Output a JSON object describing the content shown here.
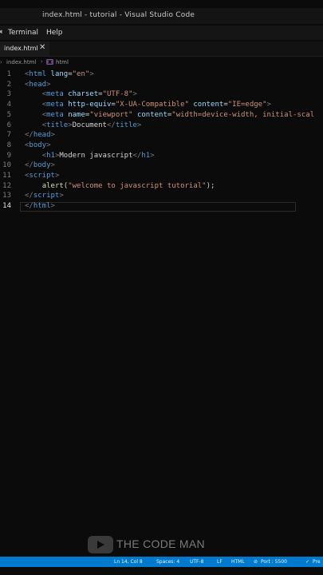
{
  "window": {
    "title": "index.html - tutorial - Visual Studio Code"
  },
  "menu": {
    "items": [
      "Terminal",
      "Help"
    ]
  },
  "tabs": [
    {
      "label": "index.html",
      "close": "✕"
    }
  ],
  "breadcrumb": {
    "file": "index.html",
    "element": "html"
  },
  "editor": {
    "lines": [
      {
        "num": "1",
        "tokens": [
          {
            "c": "br",
            "t": "<"
          },
          {
            "c": "tag",
            "t": "html"
          },
          {
            "c": "txt",
            "t": " "
          },
          {
            "c": "attr",
            "t": "lang"
          },
          {
            "c": "txt",
            "t": "="
          },
          {
            "c": "str",
            "t": "\"en\""
          },
          {
            "c": "br",
            "t": ">"
          }
        ]
      },
      {
        "num": "2",
        "tokens": [
          {
            "c": "br",
            "t": "<"
          },
          {
            "c": "tag",
            "t": "head"
          },
          {
            "c": "br",
            "t": ">"
          }
        ]
      },
      {
        "num": "3",
        "tokens": [
          {
            "c": "txt",
            "t": "    "
          },
          {
            "c": "br",
            "t": "<"
          },
          {
            "c": "tag",
            "t": "meta"
          },
          {
            "c": "txt",
            "t": " "
          },
          {
            "c": "attr",
            "t": "charset"
          },
          {
            "c": "txt",
            "t": "="
          },
          {
            "c": "str",
            "t": "\"UTF-8\""
          },
          {
            "c": "br",
            "t": ">"
          }
        ]
      },
      {
        "num": "4",
        "tokens": [
          {
            "c": "txt",
            "t": "    "
          },
          {
            "c": "br",
            "t": "<"
          },
          {
            "c": "tag",
            "t": "meta"
          },
          {
            "c": "txt",
            "t": " "
          },
          {
            "c": "attr",
            "t": "http-equiv"
          },
          {
            "c": "txt",
            "t": "="
          },
          {
            "c": "str",
            "t": "\"X-UA-Compatible\""
          },
          {
            "c": "txt",
            "t": " "
          },
          {
            "c": "attr",
            "t": "content"
          },
          {
            "c": "txt",
            "t": "="
          },
          {
            "c": "str",
            "t": "\"IE=edge\""
          },
          {
            "c": "br",
            "t": ">"
          }
        ]
      },
      {
        "num": "5",
        "tokens": [
          {
            "c": "txt",
            "t": "    "
          },
          {
            "c": "br",
            "t": "<"
          },
          {
            "c": "tag",
            "t": "meta"
          },
          {
            "c": "txt",
            "t": " "
          },
          {
            "c": "attr",
            "t": "name"
          },
          {
            "c": "txt",
            "t": "="
          },
          {
            "c": "str",
            "t": "\"viewport\""
          },
          {
            "c": "txt",
            "t": " "
          },
          {
            "c": "attr",
            "t": "content"
          },
          {
            "c": "txt",
            "t": "="
          },
          {
            "c": "str",
            "t": "\"width=device-width, initial-scal"
          }
        ]
      },
      {
        "num": "6",
        "tokens": [
          {
            "c": "txt",
            "t": "    "
          },
          {
            "c": "br",
            "t": "<"
          },
          {
            "c": "tag",
            "t": "title"
          },
          {
            "c": "br",
            "t": ">"
          },
          {
            "c": "txt",
            "t": "Document"
          },
          {
            "c": "br",
            "t": "</"
          },
          {
            "c": "tag",
            "t": "title"
          },
          {
            "c": "br",
            "t": ">"
          }
        ]
      },
      {
        "num": "7",
        "tokens": [
          {
            "c": "br",
            "t": "</"
          },
          {
            "c": "tag",
            "t": "head"
          },
          {
            "c": "br",
            "t": ">"
          }
        ]
      },
      {
        "num": "8",
        "tokens": [
          {
            "c": "br",
            "t": "<"
          },
          {
            "c": "tag",
            "t": "body"
          },
          {
            "c": "br",
            "t": ">"
          }
        ]
      },
      {
        "num": "9",
        "tokens": [
          {
            "c": "txt",
            "t": "    "
          },
          {
            "c": "br",
            "t": "<"
          },
          {
            "c": "tag",
            "t": "h1"
          },
          {
            "c": "br",
            "t": ">"
          },
          {
            "c": "txt",
            "t": "Modern javascript"
          },
          {
            "c": "br",
            "t": "</"
          },
          {
            "c": "tag",
            "t": "h1"
          },
          {
            "c": "br",
            "t": ">"
          }
        ]
      },
      {
        "num": "10",
        "tokens": [
          {
            "c": "br",
            "t": "</"
          },
          {
            "c": "tag",
            "t": "body"
          },
          {
            "c": "br",
            "t": ">"
          }
        ]
      },
      {
        "num": "11",
        "tokens": [
          {
            "c": "br",
            "t": "<"
          },
          {
            "c": "tag",
            "t": "script"
          },
          {
            "c": "br",
            "t": ">"
          }
        ]
      },
      {
        "num": "12",
        "tokens": [
          {
            "c": "txt",
            "t": "    "
          },
          {
            "c": "fn",
            "t": "alert"
          },
          {
            "c": "txt",
            "t": "("
          },
          {
            "c": "str",
            "t": "\"welcome to javascript tutorial\""
          },
          {
            "c": "txt",
            "t": ");"
          }
        ]
      },
      {
        "num": "13",
        "tokens": [
          {
            "c": "br",
            "t": "</"
          },
          {
            "c": "tag",
            "t": "script"
          },
          {
            "c": "br",
            "t": ">"
          }
        ]
      },
      {
        "num": "14",
        "tokens": [
          {
            "c": "br",
            "t": "</"
          },
          {
            "c": "tag",
            "t": "html"
          },
          {
            "c": "br",
            "t": ">"
          }
        ]
      }
    ],
    "active_line": 14
  },
  "watermark": {
    "text": "THE CODE MAN"
  },
  "status": {
    "position": "Ln 14, Col 8",
    "spaces": "Spaces: 4",
    "encoding": "UTF-8",
    "eol": "LF",
    "language": "HTML",
    "port": "Port : 5500",
    "prettier": "Pre"
  }
}
